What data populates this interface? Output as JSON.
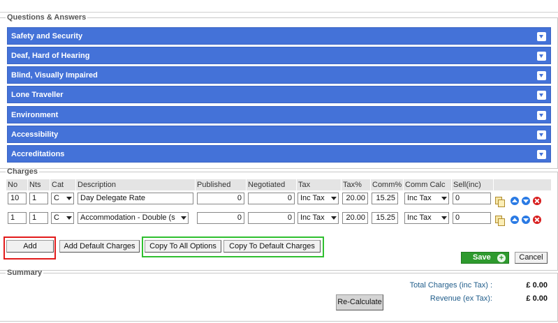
{
  "qa": {
    "legend": "Questions & Answers",
    "items": [
      {
        "label": "Safety and Security"
      },
      {
        "label": "Deaf, Hard of Hearing"
      },
      {
        "label": "Blind, Visually Impaired"
      },
      {
        "label": "Lone Traveller"
      },
      {
        "label": "Environment"
      },
      {
        "label": "Accessibility"
      },
      {
        "label": "Accreditations"
      }
    ]
  },
  "charges": {
    "legend": "Charges",
    "columns": [
      "No",
      "Nts",
      "Cat",
      "Description",
      "Published",
      "Negotiated",
      "Tax",
      "Tax%",
      "Comm%",
      "Comm Calc",
      "Sell(inc)"
    ],
    "rows": [
      {
        "no": "10",
        "nts": "1",
        "cat": "C",
        "description": "Day Delegate Rate",
        "published": "0",
        "negotiated": "0",
        "tax": "Inc Tax",
        "tax_pct": "20.00",
        "comm_pct": "15.25",
        "comm_calc": "Inc Tax",
        "sell": "0"
      },
      {
        "no": "1",
        "nts": "1",
        "cat": "C",
        "description": "Accommodation - Double (s",
        "published": "0",
        "negotiated": "0",
        "tax": "Inc Tax",
        "tax_pct": "20.00",
        "comm_pct": "15.25",
        "comm_calc": "Inc Tax",
        "sell": "0"
      }
    ],
    "buttons": {
      "add": "Add",
      "add_default": "Add Default Charges",
      "copy_all": "Copy To All Options",
      "copy_default": "Copy To Default Charges",
      "save": "Save",
      "cancel": "Cancel"
    },
    "highlight_colors": {
      "red": "#e21b1b",
      "green": "#2fbf2f"
    }
  },
  "summary": {
    "legend": "Summary",
    "recalculate": "Re-Calculate",
    "total_label": "Total Charges (inc Tax) :",
    "total_value": "£ 0.00",
    "revenue_label": "Revenue (ex Tax):",
    "revenue_value": "£ 0.00"
  },
  "colors": {
    "qa_bar": "#4472d8",
    "save": "#2e9a2e"
  }
}
